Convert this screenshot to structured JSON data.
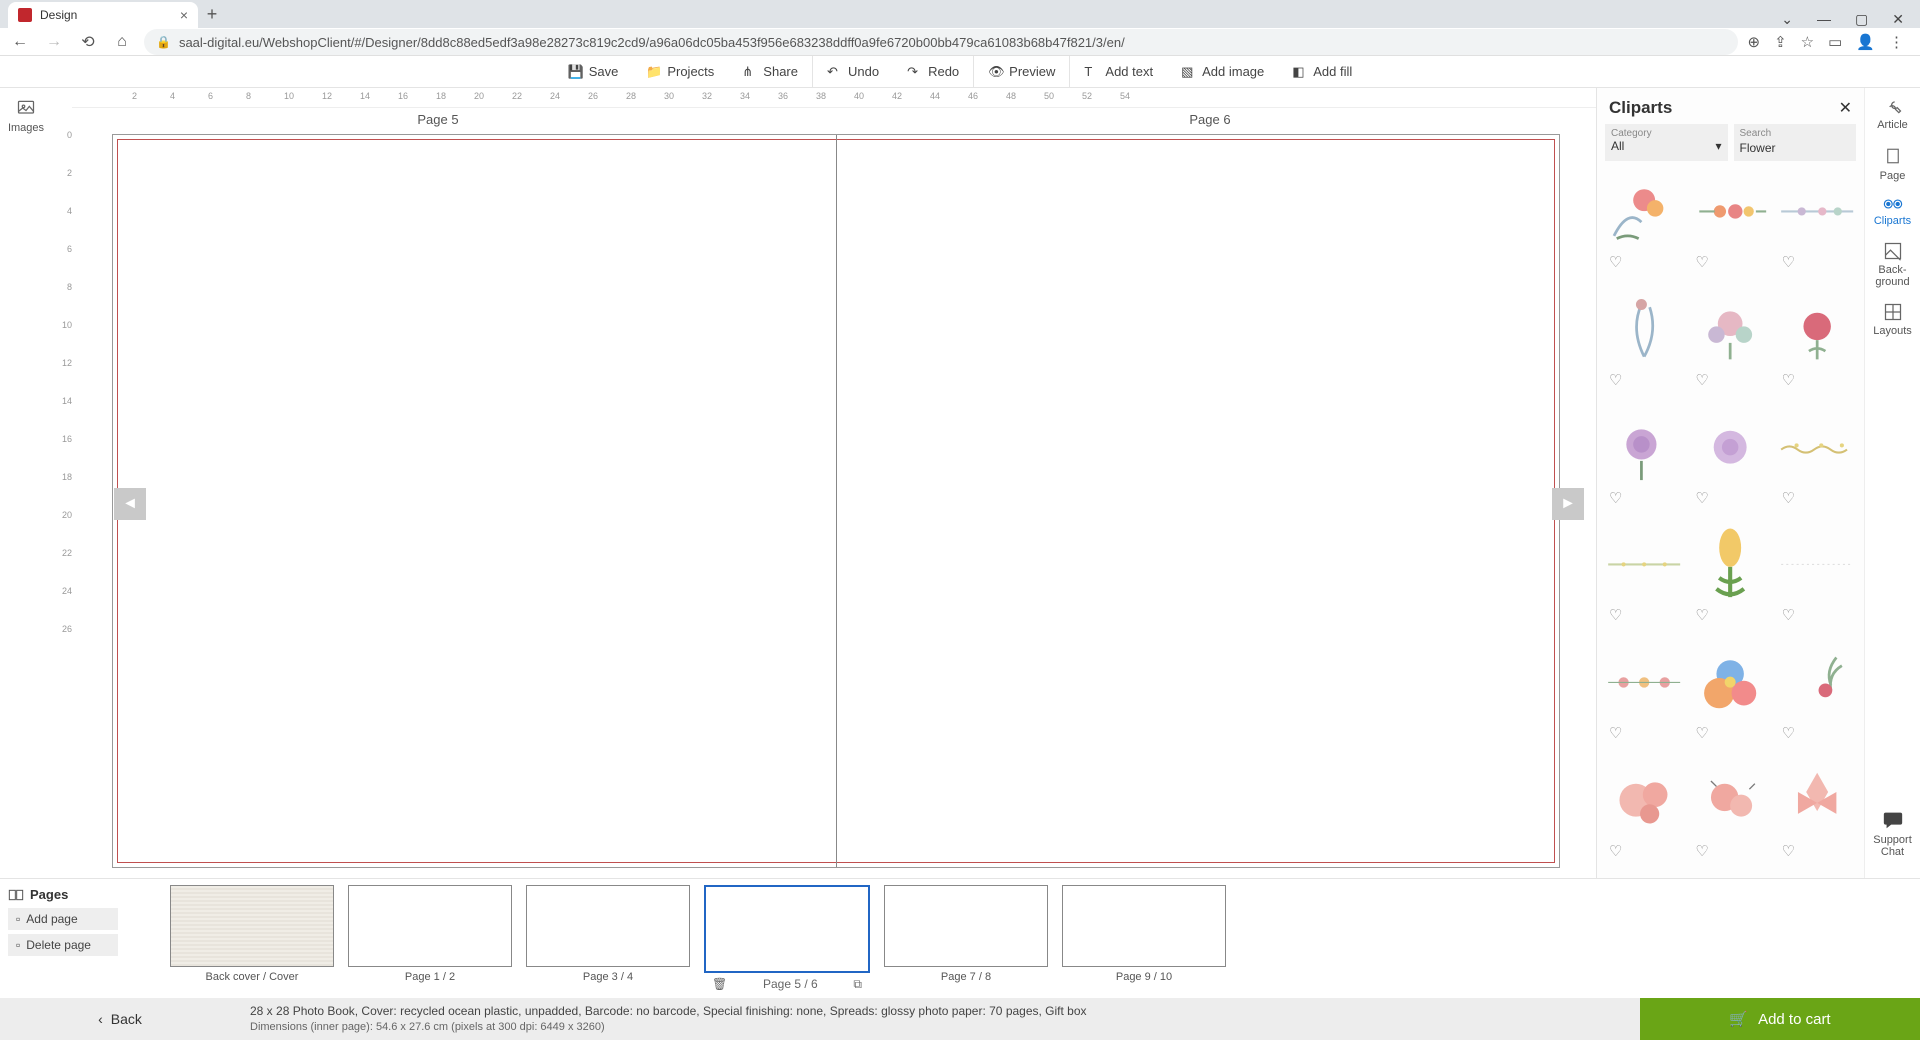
{
  "browser": {
    "tab_title": "Design",
    "url": "saal-digital.eu/WebshopClient/#/Designer/8dd8c88ed5edf3a98e28273c819c2cd9/a96a06dc05ba453f956e683238ddff0a9fe6720b00bb479ca61083b68b47f821/3/en/"
  },
  "toolbar": {
    "save": "Save",
    "projects": "Projects",
    "share": "Share",
    "undo": "Undo",
    "redo": "Redo",
    "preview": "Preview",
    "add_text": "Add text",
    "add_image": "Add image",
    "add_fill": "Add fill"
  },
  "left_rail": {
    "images": "Images"
  },
  "right_rail": {
    "article": "Article",
    "page": "Page",
    "cliparts": "Cliparts",
    "background": "Back-\nground",
    "layouts": "Layouts",
    "support": "Support\nChat"
  },
  "canvas": {
    "page_left": "Page 5",
    "page_right": "Page 6",
    "h_ticks": [
      "2",
      "4",
      "6",
      "8",
      "10",
      "12",
      "14",
      "16",
      "18",
      "20",
      "22",
      "24",
      "26",
      "28",
      "30",
      "32",
      "34",
      "36",
      "38",
      "40",
      "42",
      "44",
      "46",
      "48",
      "50",
      "52",
      "54"
    ],
    "v_ticks": [
      "0",
      "2",
      "4",
      "6",
      "8",
      "10",
      "12",
      "14",
      "16",
      "18",
      "20",
      "22",
      "24",
      "26"
    ]
  },
  "pages_strip": {
    "title": "Pages",
    "add_page": "Add page",
    "delete_page": "Delete page",
    "thumbs": [
      {
        "label": "Back cover / Cover",
        "cover": true
      },
      {
        "label": "Page 1 / 2"
      },
      {
        "label": "Page 3 / 4"
      },
      {
        "label": "Page 5 / 6",
        "selected": true
      },
      {
        "label": "Page 7 / 8"
      },
      {
        "label": "Page 9 / 10"
      }
    ]
  },
  "footer": {
    "back": "Back",
    "line1": "28 x 28 Photo Book, Cover: recycled ocean plastic, unpadded, Barcode: no barcode, Special finishing: none, Spreads: glossy photo paper: 70 pages, Gift box",
    "line2": "Dimensions (inner page): 54.6 x 27.6 cm (pixels at 300 dpi: 6449 x 3260)",
    "add_to_cart": "Add to cart"
  },
  "cliparts": {
    "title": "Cliparts",
    "category_label": "Category",
    "category_value": "All",
    "search_label": "Search",
    "search_value": "Flower"
  }
}
